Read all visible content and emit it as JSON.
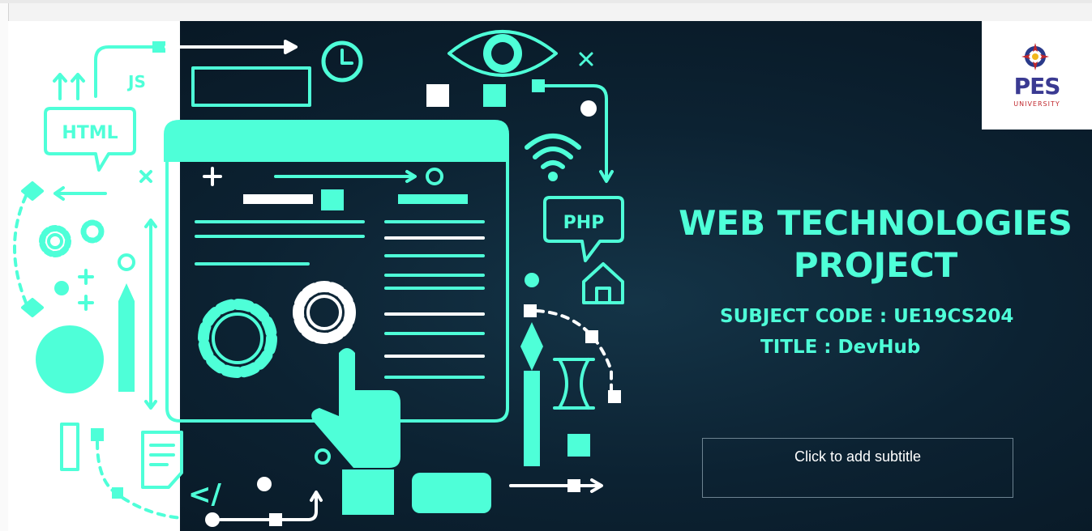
{
  "slide": {
    "heading_line1": "WEB TECHNOLOGIES",
    "heading_line2": "PROJECT",
    "subject_code": "SUBJECT CODE : UE19CS204",
    "title_line": "TITLE : DevHub",
    "subtitle_placeholder": "Click to add subtitle"
  },
  "logo": {
    "name": "PES",
    "sub": "UNIVERSITY"
  },
  "illustration": {
    "labels": {
      "js": "JS",
      "html": "HTML",
      "php": "PHP",
      "code": "</"
    }
  },
  "colors": {
    "accent": "#4effd8",
    "slide_bg": "#0c2232",
    "logo_text": "#3a3a92",
    "logo_sub": "#c0272d"
  }
}
